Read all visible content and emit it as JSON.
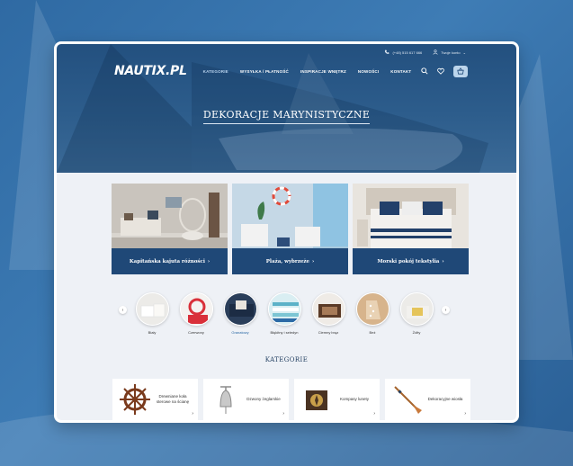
{
  "topbar": {
    "phone": "(+48) 515 617 666",
    "account": "Twoje konto"
  },
  "brand": {
    "logo": "NAUTIX.PL"
  },
  "menu": [
    {
      "label": "KATEGORIE",
      "active": true
    },
    {
      "label": "WYSYŁKA / PŁATNOŚĆ",
      "active": false
    },
    {
      "label": "INSPIRACJE WNĘTRZ",
      "active": false
    },
    {
      "label": "NOWOŚCI",
      "active": false
    },
    {
      "label": "KONTAKT",
      "active": false
    }
  ],
  "hero": {
    "title": "DEKORACJE MARYNISTYCZNE"
  },
  "features": [
    {
      "label": "Kapitańska kajuta różności"
    },
    {
      "label": "Plaża, wybrzeże"
    },
    {
      "label": "Morski pokój tekstylia"
    }
  ],
  "colors": [
    {
      "label": "Biały"
    },
    {
      "label": "Czerwony"
    },
    {
      "label": "Granatowy"
    },
    {
      "label": "Błękitny i seledyn"
    },
    {
      "label": "Ciemny brąz"
    },
    {
      "label": "Beż"
    },
    {
      "label": "Żółty"
    }
  ],
  "categories": {
    "title": "KATEGORIE",
    "items": [
      {
        "label": "Drewniane koła sterowe na ścianę"
      },
      {
        "label": "Dzwony żeglarskie"
      },
      {
        "label": "Kompasy lunety"
      },
      {
        "label": "Dekoracyjne wiosła"
      }
    ]
  },
  "accent": "#1f4877"
}
